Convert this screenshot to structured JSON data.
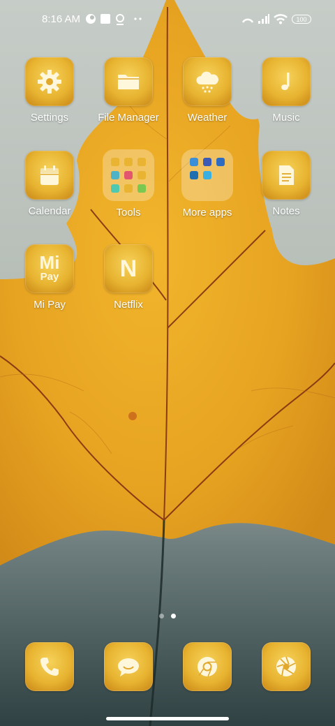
{
  "status_bar": {
    "time": "8:16 AM",
    "battery": "100",
    "icons": [
      "notification-c-icon",
      "square-notification-icon",
      "location-icon",
      "more-dots-icon",
      "hotspot-icon",
      "signal-icon",
      "wifi-icon",
      "battery-icon"
    ]
  },
  "apps": [
    {
      "label": "Settings",
      "icon": "gear-icon"
    },
    {
      "label": "File Manager",
      "icon": "folder-icon"
    },
    {
      "label": "Weather",
      "icon": "cloud-snow-icon"
    },
    {
      "label": "Music",
      "icon": "music-note-icon"
    },
    {
      "label": "Calendar",
      "icon": "calendar-icon"
    },
    {
      "label": "Tools",
      "icon": "folder-grid-icon"
    },
    {
      "label": "More apps",
      "icon": "folder-grid-icon"
    },
    {
      "label": "Notes",
      "icon": "note-icon"
    },
    {
      "label": "Mi Pay",
      "icon": "mi-pay-icon",
      "icon_text_1": "Mi",
      "icon_text_2": "Pay"
    },
    {
      "label": "Netflix",
      "icon": "netflix-icon",
      "icon_text_1": "N"
    }
  ],
  "dock": [
    {
      "name": "Phone",
      "icon": "phone-icon"
    },
    {
      "name": "Messages",
      "icon": "message-icon"
    },
    {
      "name": "Chrome",
      "icon": "chrome-icon"
    },
    {
      "name": "Camera",
      "icon": "camera-aperture-icon"
    }
  ],
  "pages": {
    "count": 2,
    "current": 2
  },
  "colors": {
    "icon_gold": "#e8b431",
    "icon_glyph": "#fff7dc",
    "leaf_orange": "#e7a62a"
  }
}
